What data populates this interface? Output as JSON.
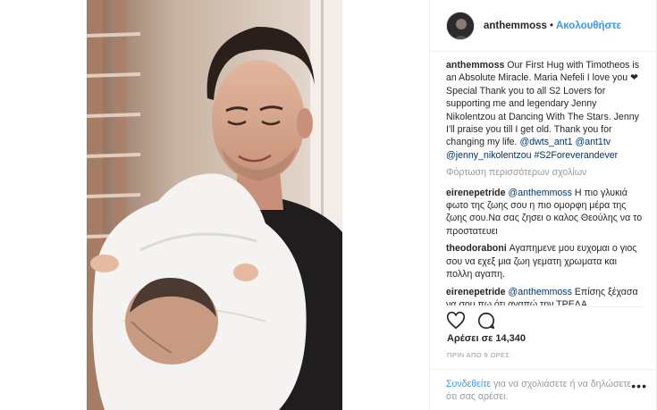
{
  "header": {
    "username": "anthemmoss",
    "separator": "•",
    "follow_label": "Ακολουθήστε"
  },
  "caption": {
    "username": "anthemmoss",
    "text_1": " Our First Hug with Timotheos is an Absolute Miracle. Maria Nefeli I love you ",
    "heart": "❤",
    "text_2": " Special Thank you to all S2 Lovers for supporting me and legendary Jenny Nikolentzou at Dancing With The Stars. Jenny I'll praise you till I get old. Thank you for changing my life. ",
    "mention_1": "@dwts_ant1",
    "mention_2": "@ant1tv",
    "mention_3": "@jenny_nikolentzou",
    "hashtag": "#S2Foreverandever"
  },
  "load_more": "Φόρτωση περισσότερων σχολίων",
  "comments": [
    {
      "username": "eirenepetride",
      "mention": "@anthemmoss",
      "text": " Η πιο γλυκιά φωτο της ζωης σου η πιο ομορφη μέρα της ζωης σου.Να σας ζησει ο καλος Θεούλης να το προστατευει"
    },
    {
      "username": "theodoraboni",
      "mention": "",
      "text": " Αγαπημενε μου ευχομαι ο γιος σου να εχεξ μια ζωη γεματη χρωματα και πολλη αγαπη."
    },
    {
      "username": "eirenepetride",
      "mention": "@anthemmoss",
      "text": " Επίσης ξέχασα να σου πω ότι αγαπώ την ΤΡΕΛΑ"
    }
  ],
  "likes_label": "Αρέσει σε 14,340",
  "time_label": "ΠΡΙΝ ΑΠΟ 9 ΩΡΕΣ",
  "footer": {
    "login_link": "Συνδεθείτε",
    "text": " για να σχολιάσετε ή να δηλώσετε ότι σας αρέσει."
  },
  "more_label": "•••",
  "icons": {
    "like": "heart-outline",
    "comment": "speech-bubble",
    "more": "three-dots"
  },
  "colors": {
    "link": "#3897f0",
    "mention": "#003569",
    "muted": "#999999"
  }
}
